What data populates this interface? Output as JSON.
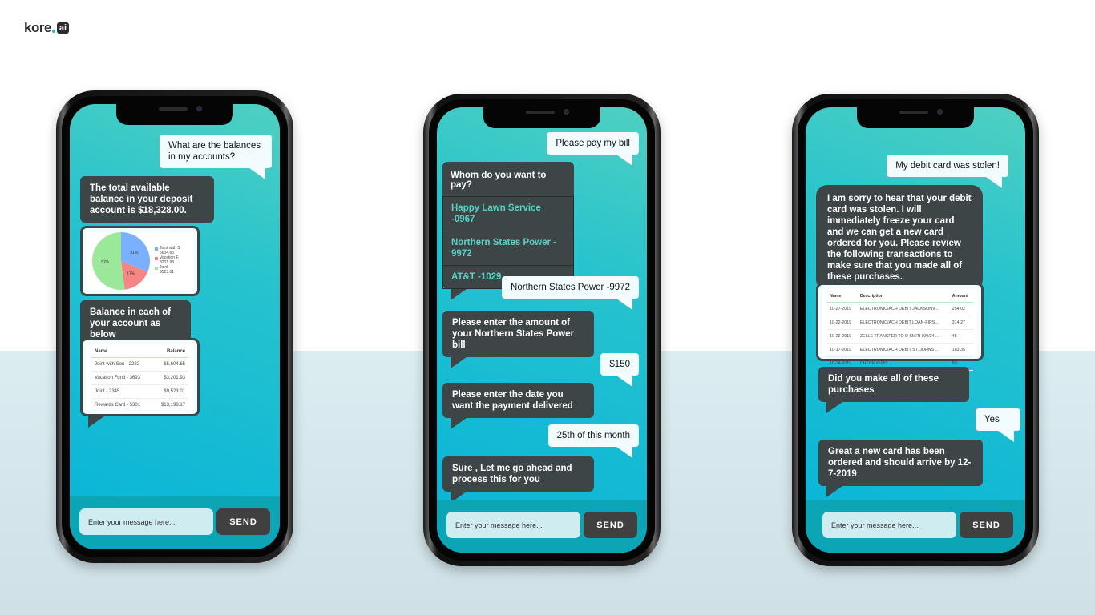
{
  "brand": {
    "name": "kore",
    "suffix": "ai"
  },
  "composer": {
    "placeholder": "Enter your message here...",
    "send_label": "SEND"
  },
  "phones": [
    {
      "messages": {
        "user1": "What are the balances in my accounts?",
        "bot1": "The total available balance in your deposit account is $18,328.00.",
        "bot2": "Balance in each of your account as below"
      },
      "pie": {
        "slices": [
          {
            "label": "Joint with S",
            "value": "5604.65",
            "percent": 31,
            "pct_label": "31%",
            "color": "#7ab0ff"
          },
          {
            "label": "Vacation F.",
            "value": "3201.93",
            "percent": 17,
            "pct_label": "17%",
            "color": "#f48686"
          },
          {
            "label": "Joint",
            "value": "9523.01",
            "percent": 52,
            "pct_label": "52%",
            "color": "#9be89a"
          }
        ]
      },
      "balances": {
        "headers": [
          "Name",
          "Balance"
        ],
        "rows": [
          [
            "Joint with Son - 2222",
            "$5,604.65"
          ],
          [
            "Vacation Fund - 3693",
            "$3,201.93"
          ],
          [
            "Joint - 2345",
            "$9,523.01"
          ],
          [
            "Rewards Card - 5301",
            "$13,198.17"
          ]
        ]
      }
    },
    {
      "messages": {
        "user1": "Please pay my bill",
        "bot_question": "Whom do you want to pay?",
        "options": [
          "Happy Lawn Service -0967",
          "Northern States Power - 9972",
          "AT&T -1029"
        ],
        "user2": "Northern States Power -9972",
        "bot2": "Please enter the amount of your Northern States Power bill",
        "user3": "$150",
        "bot3": "Please enter the date you want the payment delivered",
        "user4": "25th of this month",
        "bot4": "Sure , Let me go ahead and process this for you"
      }
    },
    {
      "messages": {
        "user1": "My debit card was stolen!",
        "bot1": "I am sorry to hear that your debit card was stolen. I will immediately freeze your card and we can get a new card ordered for you. Please review the following transactions to make sure that you made all of these purchases.",
        "bot2": "Did you make all of these purchases",
        "user2": "Yes",
        "bot3": "Great a new card has been ordered and should arrive by 12-7-2019"
      },
      "transactions": {
        "headers": [
          "Name",
          "Description",
          "Amount"
        ],
        "rows": [
          [
            "10-27-2019",
            "ELECTRONIC/ACH DEBIT JACKSONV...",
            "254.02"
          ],
          [
            "10-22-2019",
            "ELECTRONIC/ACH DEBIT LOAN-FIRS...",
            "314.27"
          ],
          [
            "10-22-2019",
            "ZELLE TRANSFER TO D SMITH 09/24 ...",
            "45"
          ],
          [
            "10-17-2019",
            "ELECTRONIC/ACH DEBIT ST. JOHNS ...",
            "183.35"
          ],
          [
            "10-14-2019",
            "CHECK #5082",
            "50"
          ]
        ]
      }
    }
  ]
}
